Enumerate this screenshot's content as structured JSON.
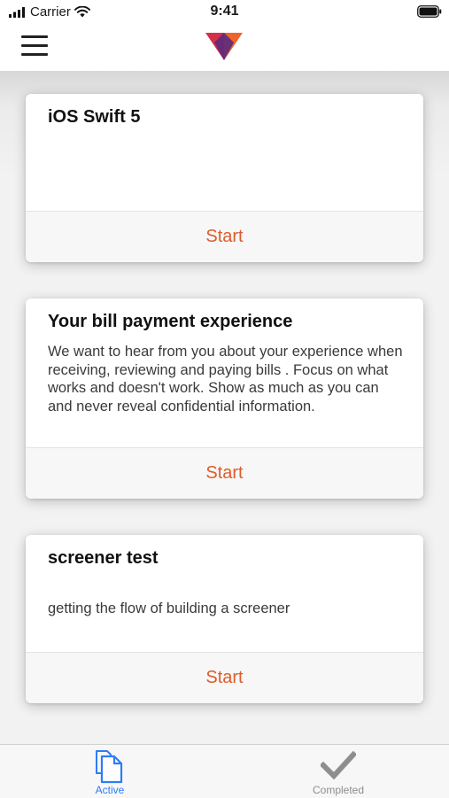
{
  "status_bar": {
    "carrier": "Carrier",
    "time": "9:41",
    "icons": [
      "signal-icon",
      "wifi-icon",
      "battery-icon"
    ]
  },
  "nav": {
    "menu_icon": "hamburger-menu-icon",
    "logo_icon": "brand-logo-icon"
  },
  "cards": [
    {
      "title": "iOS Swift 5",
      "description": "",
      "action_label": "Start"
    },
    {
      "title": "Your bill payment experience",
      "description": "We want to hear from you about your experience when receiving, reviewing and paying bills . Focus on what works and doesn't work. Show as much as you can and never reveal confidential information.",
      "action_label": "Start"
    },
    {
      "title": "screener test",
      "description": "getting the flow of building a screener",
      "action_label": "Start"
    }
  ],
  "tabs": [
    {
      "label": "Active",
      "icon": "documents-icon",
      "selected": true
    },
    {
      "label": "Completed",
      "icon": "checkmark-icon",
      "selected": false
    }
  ],
  "colors": {
    "accent": "#DD5C2B",
    "tab_active": "#2E7CF6",
    "tab_inactive": "#8E8E8E",
    "logo_red": "#D32F4A",
    "logo_orange": "#F0632A",
    "logo_purple": "#5B2A7E"
  }
}
